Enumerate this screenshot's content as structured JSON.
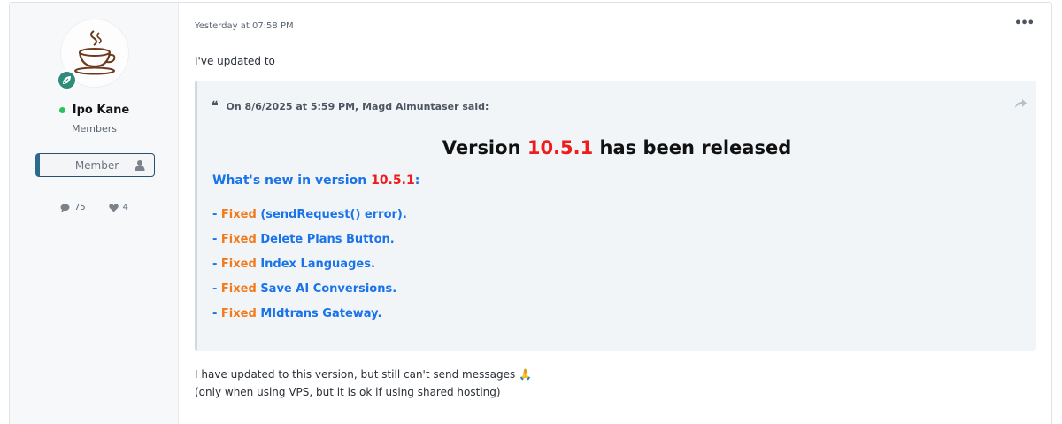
{
  "user": {
    "name": "Ipo Kane",
    "title": "Members",
    "banner": "Member",
    "messages_count": "75",
    "reactions_count": "4",
    "online_color": "#2bc35b",
    "avatar_icon": "coffee-cup-icon",
    "rank_icon": "leaf-icon"
  },
  "post": {
    "date": "Yesterday at 07:58 PM",
    "more_label": "•••",
    "intro": "I've updated to",
    "quote": {
      "attribution": "On 8/6/2025 at 5:59 PM, Magd Almuntaser said:",
      "title_prefix": "Version",
      "title_version": "10.5.1",
      "title_suffix": "has been released",
      "whats_new_prefix": "What's new in version",
      "whats_new_version": "10.5.1",
      "whats_new_suffix": ":",
      "fixes": [
        {
          "dash": "- ",
          "tag": "Fixed",
          "text": "(sendRequest() error)."
        },
        {
          "dash": "- ",
          "tag": "Fixed",
          "text": "Delete Plans Button."
        },
        {
          "dash": "- ",
          "tag": "Fixed",
          "text": "Index Languages."
        },
        {
          "dash": "- ",
          "tag": "Fixed",
          "text": "Save AI Conversions."
        },
        {
          "dash": "- ",
          "tag": "Fixed",
          "text": "MIdtrans Gateway."
        }
      ]
    },
    "body_line1": "I have updated to this version, but still can't send messages",
    "body_emoji": "🙏",
    "body_line2": "(only when using VPS, but it is ok if using shared hosting)"
  },
  "colors": {
    "link_blue": "#1a73e8",
    "version_red": "#ee1c1c",
    "fixed_orange": "#f27a1a"
  }
}
